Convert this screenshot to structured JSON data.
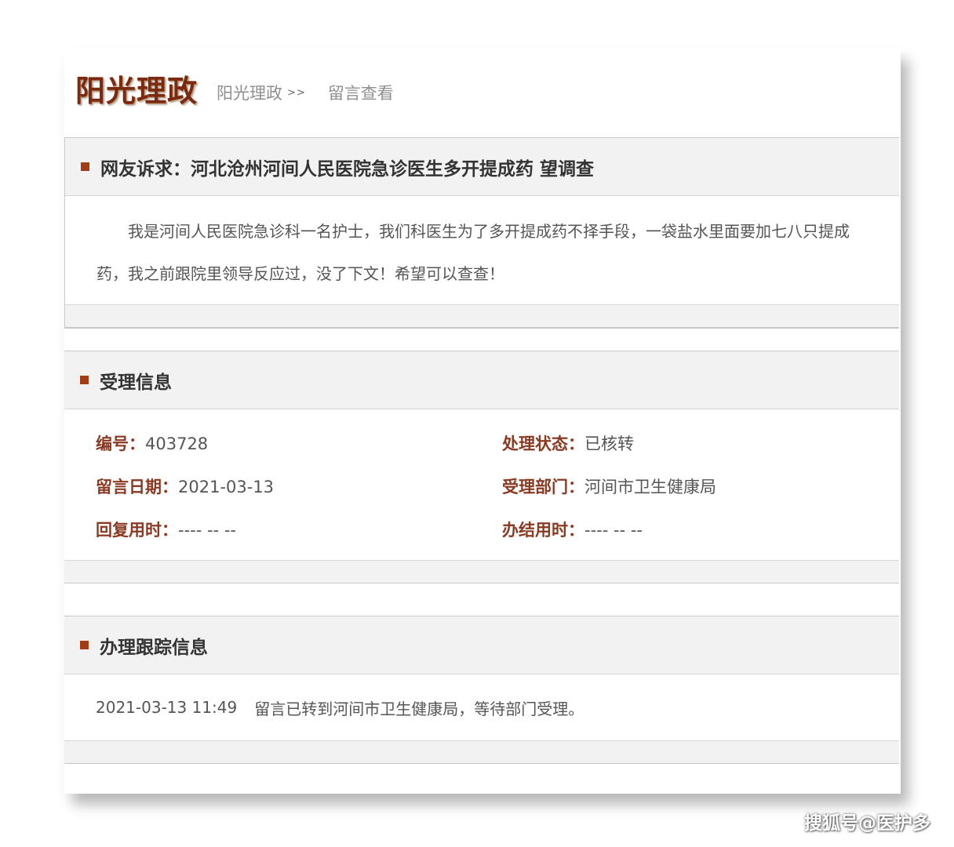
{
  "header": {
    "logo_text": "阳光理政",
    "breadcrumb": {
      "home": "阳光理政",
      "separator": ">>",
      "current": "留言查看"
    }
  },
  "complaint": {
    "title": "网友诉求：河北沧州河间人民医院急诊医生多开提成药 望调查",
    "content": "我是河间人民医院急诊科一名护士，我们科医生为了多开提成药不择手段，一袋盐水里面要加七八只提成药，我之前跟院里领导反应过，没了下文！希望可以查查！"
  },
  "acceptance": {
    "title": "受理信息",
    "number_label": "编号：",
    "number_value": "403728",
    "status_label": "处理状态：",
    "status_value": "已核转",
    "date_label": "留言日期：",
    "date_value": "2021-03-13",
    "dept_label": "受理部门：",
    "dept_value": "河间市卫生健康局",
    "reply_time_label": "回复用时：",
    "reply_time_value": "---- -- --",
    "finish_time_label": "办结用时：",
    "finish_time_value": "---- -- --"
  },
  "tracking": {
    "title": "办理跟踪信息",
    "entries": [
      {
        "time": "2021-03-13 11:49",
        "text": "留言已转到河间市卫生健康局，等待部门受理。"
      }
    ]
  },
  "watermark": "搜狐号@医护多",
  "colors": {
    "marker": "#a23c14",
    "label": "#8a3a22",
    "logo": "#7a2a10",
    "panel_bg": "#f2f2f2"
  }
}
